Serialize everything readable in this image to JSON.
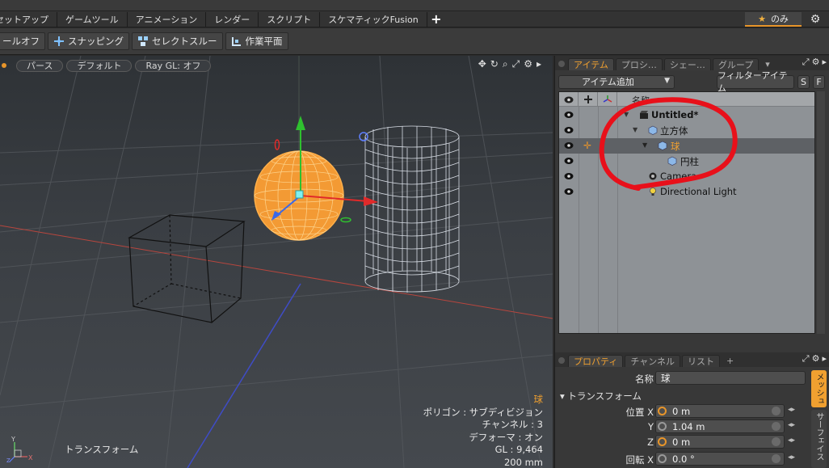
{
  "menubar": {
    "tabs": [
      "セットアップ",
      "ゲームツール",
      "アニメーション",
      "レンダー",
      "スクリプト",
      "スケマティックFusion"
    ],
    "plus": "+",
    "only_label": "のみ",
    "star": "★"
  },
  "toolbar": {
    "tool_off": "ールオフ",
    "snapping": "スナッピング",
    "select_through": "セレクトスルー",
    "work_plane": "作業平面"
  },
  "viewport": {
    "view_mode": "パース",
    "shading": "デフォルト",
    "raygl": "Ray GL: オフ",
    "selected_item": "球",
    "polygon_info": "ポリゴン : サブディビジョン",
    "channels": "チャンネル : 3",
    "deformer": "デフォーマ : オン",
    "gl": "GL : 9,464",
    "grid_size": "200 mm",
    "mode_label": "トランスフォーム",
    "axis_y": "Y",
    "axis_x": "X",
    "axis_z": "Z"
  },
  "items_panel": {
    "tabs": [
      "アイテム",
      "プロシ…",
      "シェー…",
      "グループ"
    ],
    "add_item": "アイテム追加",
    "filter": "フィルターアイテム",
    "s_btn": "S",
    "f_btn": "F",
    "name_col": "名称",
    "rows": [
      {
        "label": "Untitled*",
        "icon": "scene-icon"
      },
      {
        "label": "立方体",
        "icon": "mesh-icon"
      },
      {
        "label": "球",
        "icon": "mesh-icon"
      },
      {
        "label": "円柱",
        "icon": "mesh-icon"
      },
      {
        "label": "Camera",
        "icon": "camera-icon"
      },
      {
        "label": "Directional Light",
        "icon": "light-icon"
      }
    ]
  },
  "props_panel": {
    "tabs": [
      "プロパティ",
      "チャンネル",
      "リスト"
    ],
    "plus": "+",
    "name_label": "名称",
    "name_value": "球",
    "transform_header": "トランスフォーム",
    "position_label": "位置 X",
    "y_label": "Y",
    "z_label": "Z",
    "rotation_label": "回転 X",
    "pos_x": "0 m",
    "pos_y": "1.04 m",
    "pos_z": "0 m",
    "rot_x": "0.0 °",
    "vtab_mesh": "メッシュ",
    "vtab_surface": "サーフェイス"
  },
  "colors": {
    "accent": "#f0a030",
    "annotation": "#e8101a",
    "selection": "#ff9a1e"
  }
}
